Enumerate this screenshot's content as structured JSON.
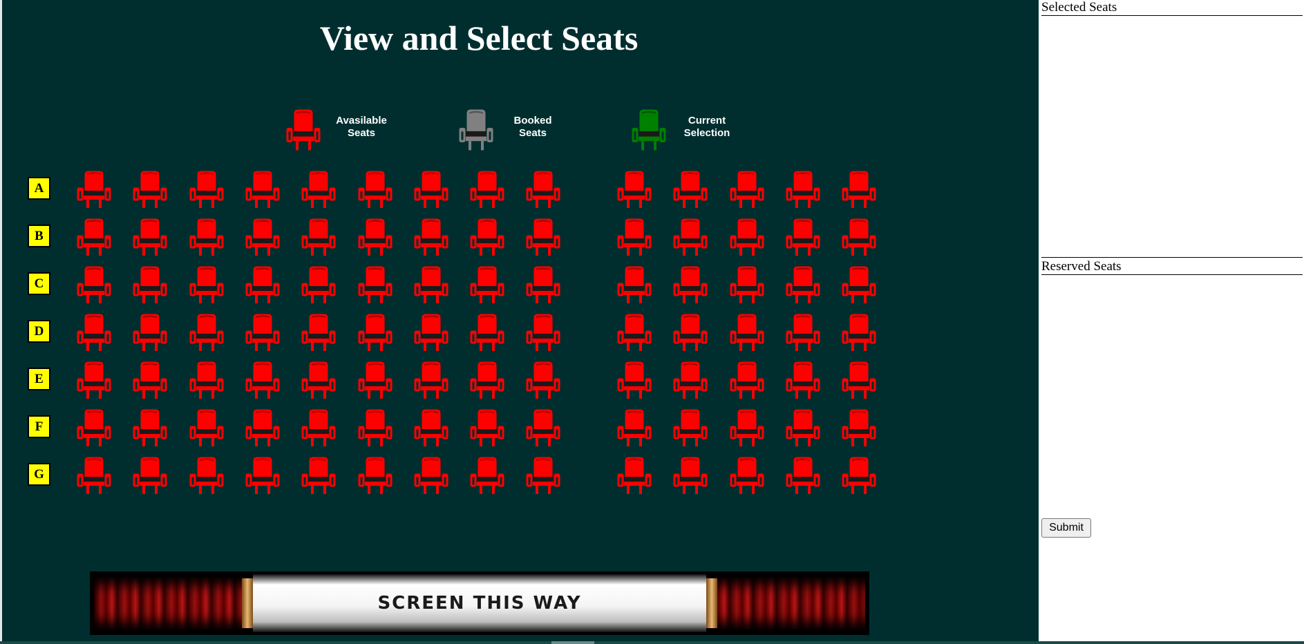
{
  "title": "View and Select Seats",
  "legend": [
    {
      "label_line1": "Avasilable",
      "label_line2": "Seats",
      "icon": "seat-available-icon",
      "color": "#ff0000"
    },
    {
      "label_line1": "Booked",
      "label_line2": "Seats",
      "icon": "seat-booked-icon",
      "color": "#808080"
    },
    {
      "label_line1": "Current",
      "label_line2": "Selection",
      "icon": "seat-selected-icon",
      "color": "#008000"
    }
  ],
  "rows": [
    "A",
    "B",
    "C",
    "D",
    "E",
    "F",
    "G"
  ],
  "seats_per_row": {
    "left_block": 9,
    "right_block": 5
  },
  "seat_color": "#ff0000",
  "screen_text": "SCREEN THIS WAY",
  "side_panel": {
    "selected_heading": "Selected Seats",
    "reserved_heading": "Reserved Seats",
    "submit_label": "Submit"
  },
  "colors": {
    "background": "#002e2f",
    "row_label_bg": "#ffff00",
    "available": "#ff0000",
    "booked": "#808080",
    "selected": "#008000"
  }
}
